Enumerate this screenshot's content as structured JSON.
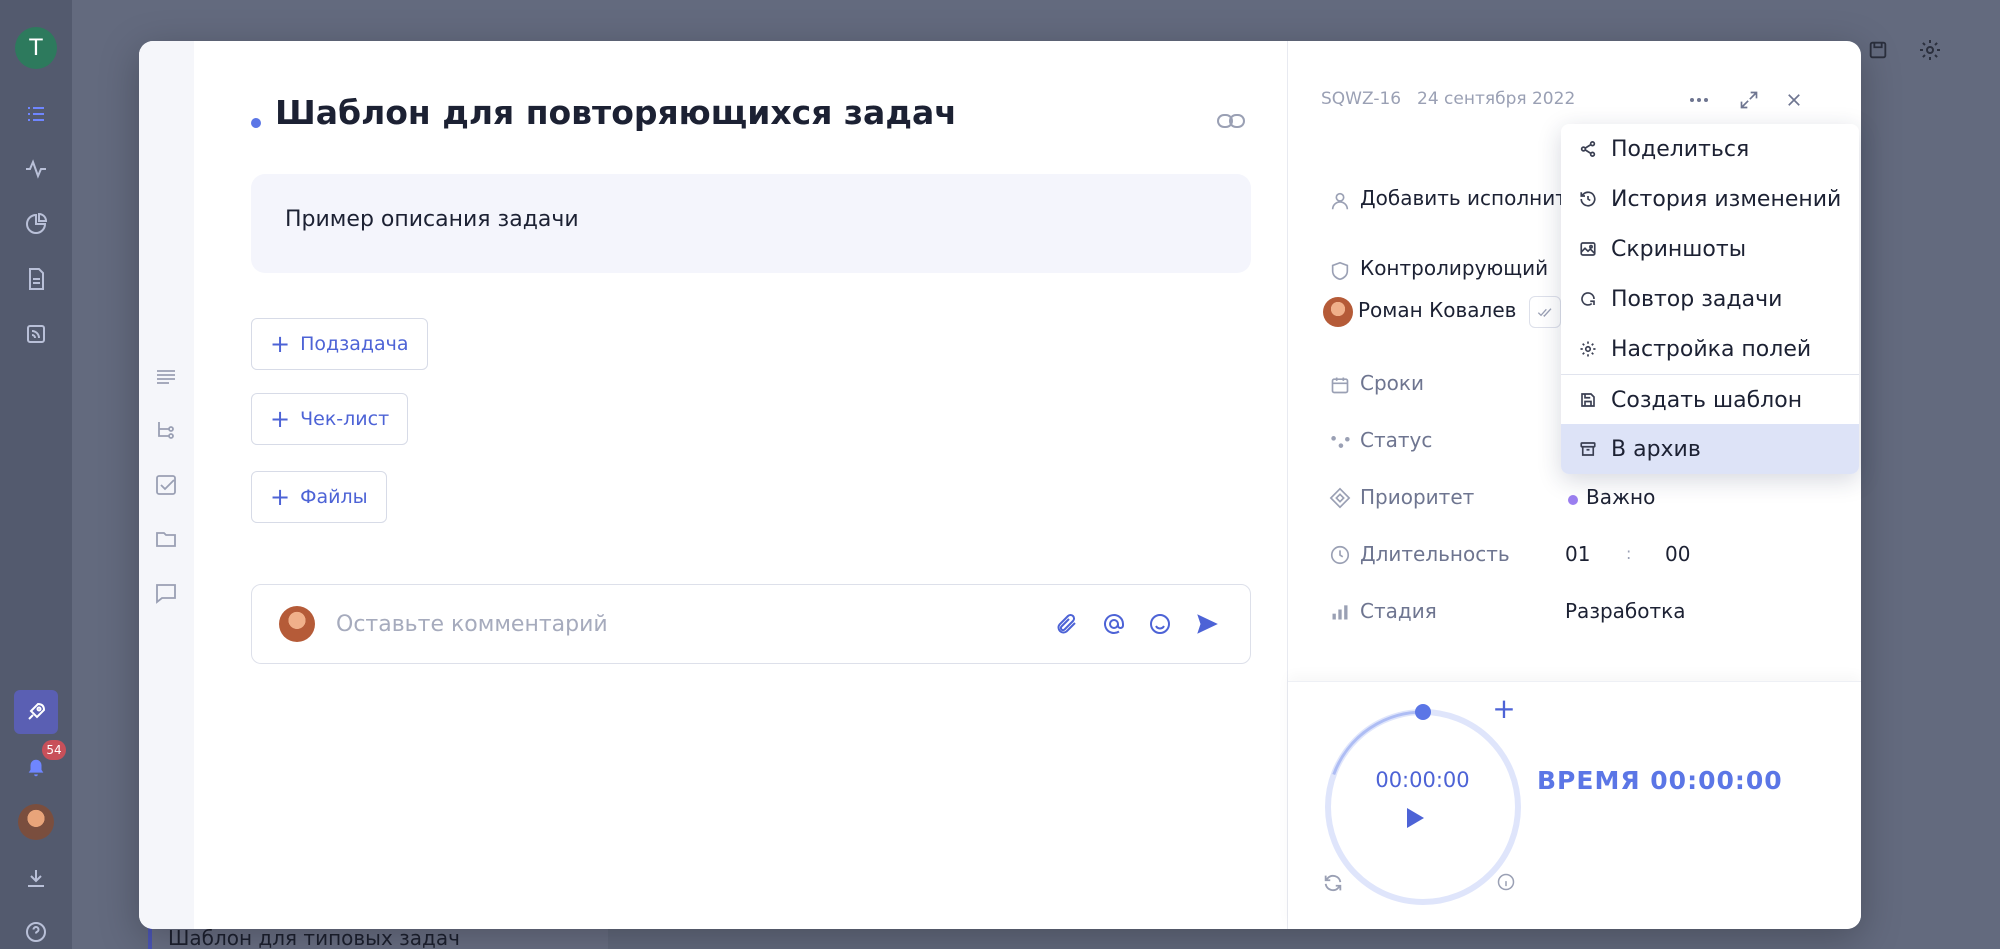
{
  "app": {
    "user_initial": "T",
    "notification_count": "54",
    "background_task": "Шаблон для типовых задач"
  },
  "task": {
    "title": "Шаблон для повторяющихся задач",
    "description": "Пример описания задачи",
    "add_subtask": "Подзадача",
    "add_checklist": "Чек-лист",
    "add_files": "Файлы",
    "comment_placeholder": "Оставьте комментарий"
  },
  "meta": {
    "id": "SQWZ-16",
    "date": "24 сентября 2022"
  },
  "fields": {
    "assignee_label": "Добавить исполнителя",
    "controller_label": "Контролирующий",
    "controller_name": "Роман Ковалев",
    "deadline_label": "Сроки",
    "status_label": "Статус",
    "priority_label": "Приоритет",
    "priority_value": "Важно",
    "duration_label": "Длительность",
    "duration_hours": "01",
    "duration_sep": ":",
    "duration_minutes": "00",
    "stage_label": "Стадия",
    "stage_value": "Разработка"
  },
  "timer": {
    "clock": "00:00:00",
    "total": "ВРЕМЯ 00:00:00",
    "progress_fraction": 0
  },
  "menu": {
    "items": [
      {
        "label": "Поделиться",
        "icon": "share-icon"
      },
      {
        "label": "История изменений",
        "icon": "history-icon"
      },
      {
        "label": "Скриншоты",
        "icon": "image-icon"
      },
      {
        "label": "Повтор задачи",
        "icon": "repeat-icon"
      },
      {
        "label": "Настройка полей",
        "icon": "gear-icon"
      },
      {
        "label": "Создать шаблон",
        "icon": "save-icon"
      },
      {
        "label": "В архив",
        "icon": "archive-icon",
        "active": true
      }
    ]
  },
  "colors": {
    "accent": "#5b76e6",
    "overlay": "#5e6479",
    "priority_dot": "#9b7ff0",
    "menu_active": "#dde3f7"
  }
}
